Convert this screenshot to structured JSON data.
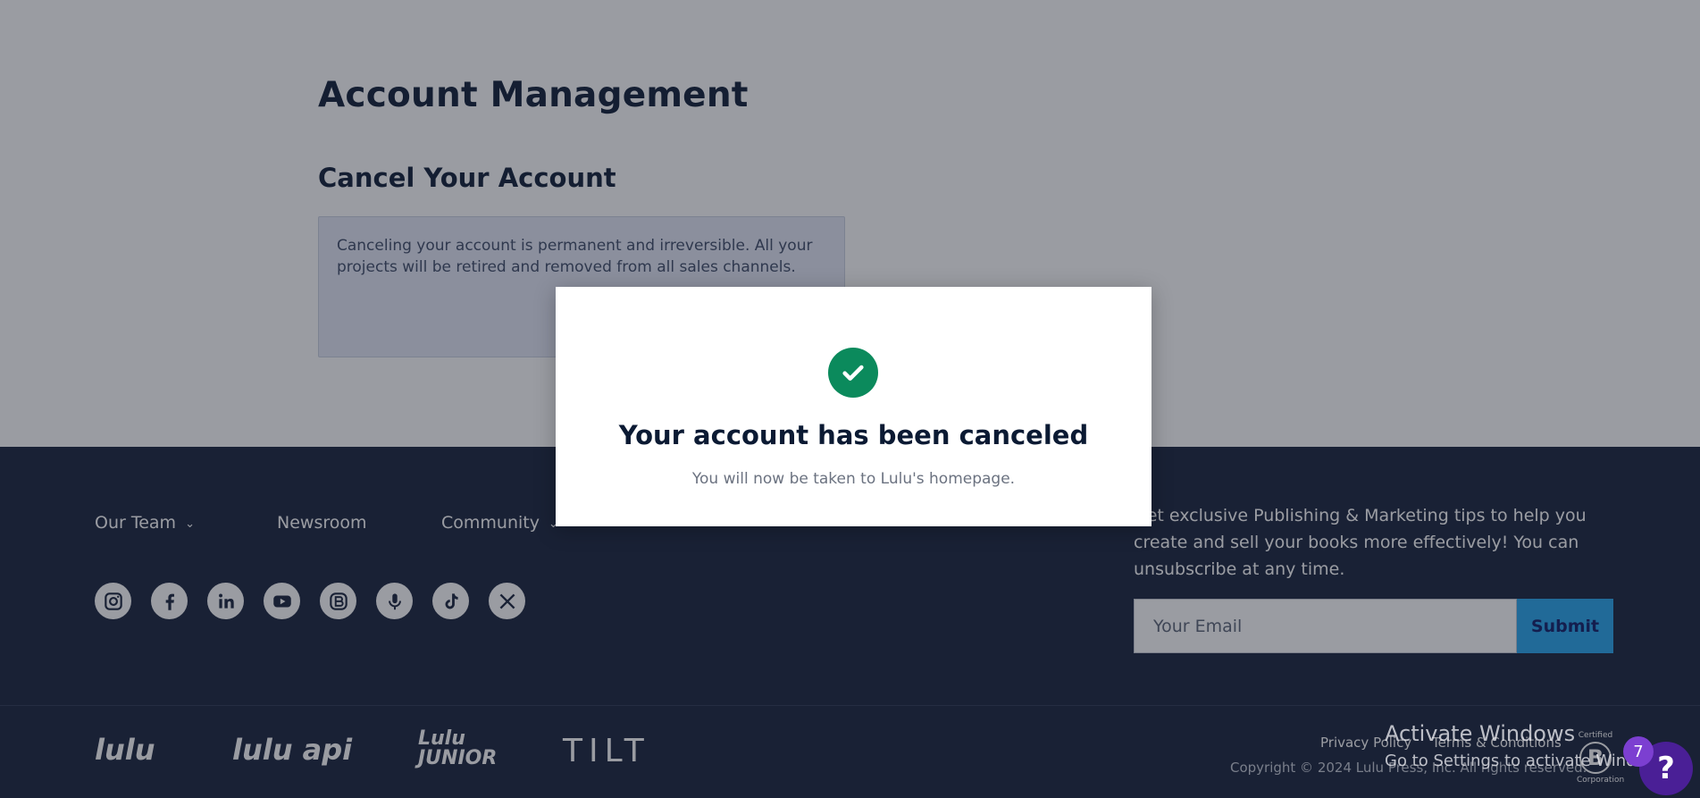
{
  "page": {
    "title": "Account Management",
    "section_title": "Cancel Your Account",
    "warning_text": "Canceling your account is permanent and irreversible. All your projects will be retired and removed from all sales channels."
  },
  "modal": {
    "icon": "check-circle-icon",
    "title": "Your account has been canceled",
    "message": "You will now be taken to Lulu's homepage."
  },
  "footer": {
    "nav": [
      "Our Team",
      "Newsroom",
      "Community"
    ],
    "socials": [
      "instagram-icon",
      "facebook-icon",
      "linkedin-icon",
      "youtube-icon",
      "blog-icon",
      "podcast-icon",
      "tiktok-icon",
      "x-icon"
    ],
    "newsletter_text": "Get exclusive Publishing & Marketing tips to help you create and sell your books more effectively! You can unsubscribe at any time.",
    "email_placeholder": "Your Email",
    "submit_label": "Submit",
    "brands": [
      "lulu",
      "lulu api",
      "Lulu JUNIOR",
      "TILT"
    ],
    "privacy_label": "Privacy Policy",
    "terms_label": "Terms & Conditions",
    "copyright": "Copyright © 2024 Lulu Press, Inc. All rights reserved.",
    "bcorp_top": "Certified",
    "bcorp_letter": "B",
    "bcorp_bottom": "Corporation"
  },
  "windows_watermark": {
    "line1": "Activate Windows",
    "line2": "Go to Settings to activate Windows."
  },
  "help": {
    "badge_count": "7",
    "label": "?"
  },
  "colors": {
    "footer_bg": "#15203a",
    "accent_blue": "#24a5ed",
    "success_green": "#0b8a5c",
    "help_purple": "#4a1f96"
  }
}
